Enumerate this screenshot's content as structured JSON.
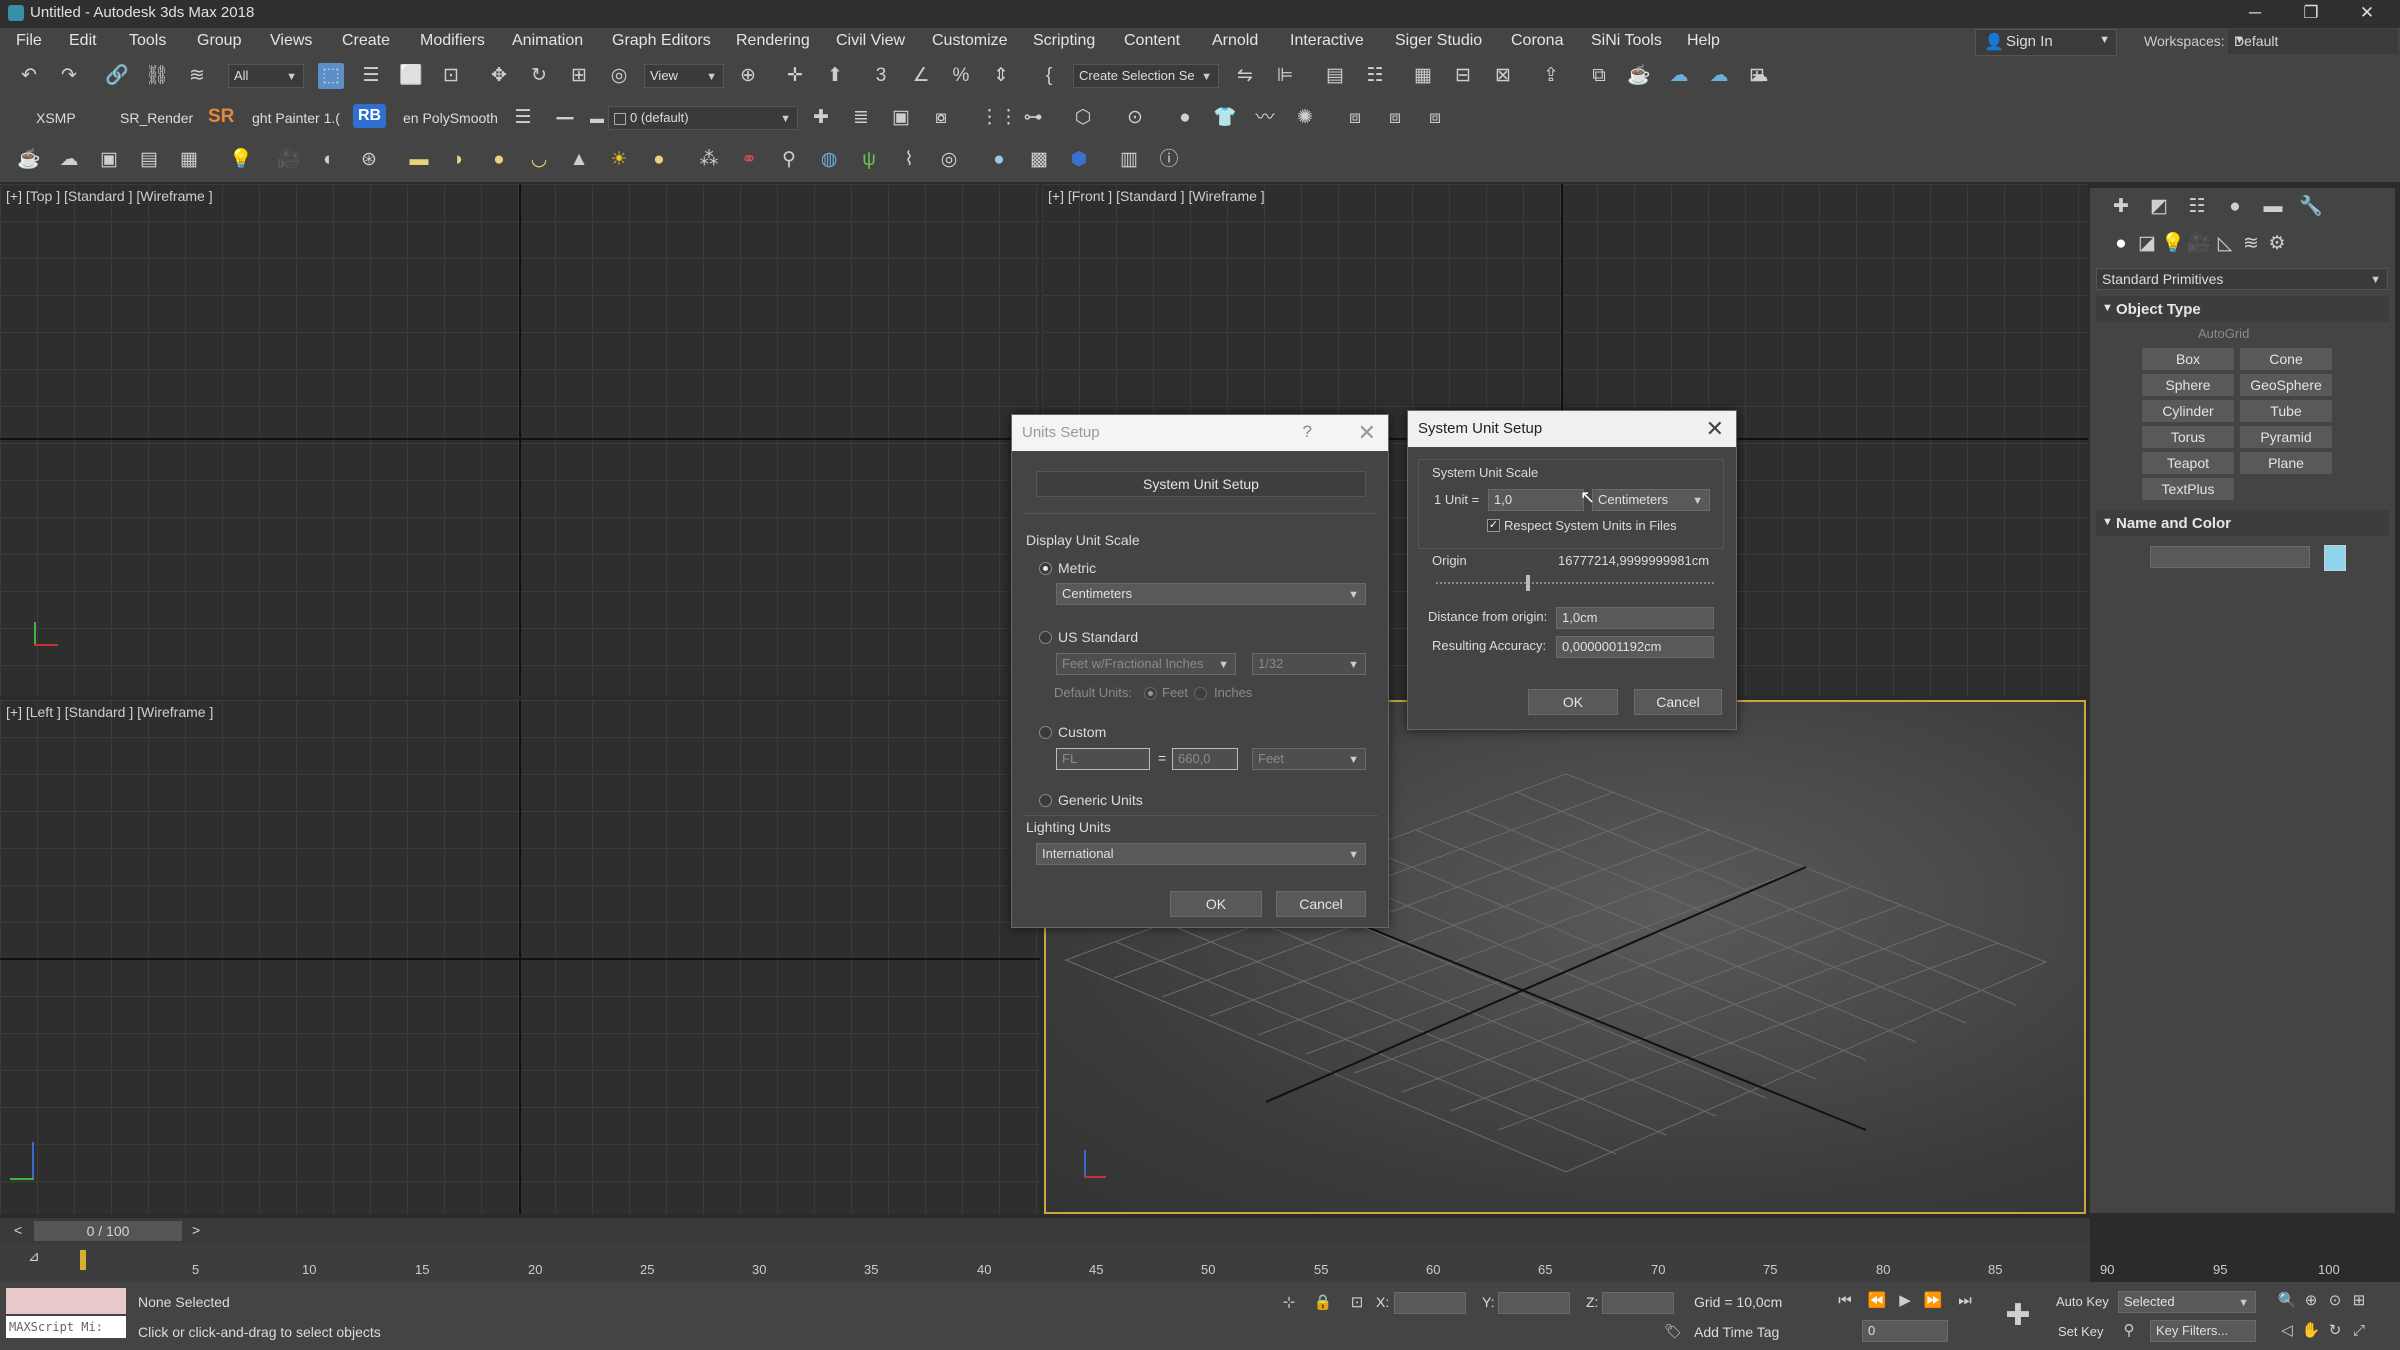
{
  "window": {
    "title": "Untitled - Autodesk 3ds Max 2018",
    "minimize": "─",
    "maximize": "❐",
    "close": "✕"
  },
  "menu": [
    "File",
    "Edit",
    "Tools",
    "Group",
    "Views",
    "Create",
    "Modifiers",
    "Animation",
    "Graph Editors",
    "Rendering",
    "Civil View",
    "Customize",
    "Scripting",
    "Content",
    "Arnold",
    "Interactive",
    "Siger Studio",
    "Corona",
    "SiNi Tools",
    "Help"
  ],
  "account": {
    "sign_in": "Sign In",
    "workspaces_label": "Workspaces:",
    "workspace": "Default"
  },
  "toolbar": {
    "filter": "All",
    "refcoord": "View",
    "selection_set": "Create Selection Se",
    "xsmp": "XSMP",
    "sr_render": "SR_Render",
    "sr": "SR",
    "light_painter": "ght Painter 1.(",
    "rb": "RB",
    "polysmooth": "en PolySmooth",
    "layer": "0 (default)"
  },
  "viewports": {
    "top": "[+] [Top ] [Standard ] [Wireframe ]",
    "front": "[+] [Front ] [Standard ] [Wireframe ]",
    "left": "[+] [Left ] [Standard ] [Wireframe ]"
  },
  "command_panel": {
    "category": "Standard Primitives",
    "object_type": "Object Type",
    "autogrid": "AutoGrid",
    "primitives": [
      "Box",
      "Cone",
      "Sphere",
      "GeoSphere",
      "Cylinder",
      "Tube",
      "Torus",
      "Pyramid",
      "Teapot",
      "Plane",
      "TextPlus"
    ],
    "name_and_color": "Name and Color",
    "color": "#8fd3ec"
  },
  "units_setup": {
    "title": "Units Setup",
    "help": "?",
    "close": "✕",
    "system_unit_button": "System Unit Setup",
    "display_unit_scale": "Display Unit Scale",
    "metric": "Metric",
    "metric_unit": "Centimeters",
    "us_standard": "US Standard",
    "us_unit": "Feet w/Fractional Inches",
    "us_fraction": "1/32",
    "default_units": "Default Units:",
    "feet": "Feet",
    "inches": "Inches",
    "custom": "Custom",
    "custom_name": "FL",
    "custom_eq": "=",
    "custom_value": "660,0",
    "custom_unit": "Feet",
    "generic_units": "Generic Units",
    "lighting_units": "Lighting Units",
    "lighting_value": "International",
    "ok": "OK",
    "cancel": "Cancel"
  },
  "system_unit_setup": {
    "title": "System Unit Setup",
    "close": "✕",
    "scale_group": "System Unit Scale",
    "unit_label": "1 Unit =",
    "unit_value": "1,0",
    "unit_type": "Centimeters",
    "respect": "Respect System Units in Files",
    "respect_checked": true,
    "origin_label": "Origin",
    "origin_value": "16777214,9999999981cm",
    "distance_label": "Distance from origin:",
    "distance_value": "1,0cm",
    "accuracy_label": "Resulting Accuracy:",
    "accuracy_value": "0,0000001192cm",
    "ok": "OK",
    "cancel": "Cancel"
  },
  "timeline": {
    "counter": "0 / 100",
    "ticks": [
      "5",
      "10",
      "15",
      "20",
      "25",
      "30",
      "35",
      "40",
      "45",
      "50",
      "55",
      "60",
      "65",
      "70",
      "75",
      "80",
      "85",
      "90",
      "95",
      "100"
    ]
  },
  "status": {
    "maxscript": "MAXScript Mi:",
    "selection": "None Selected",
    "prompt": "Click or click-and-drag to select objects",
    "x_label": "X:",
    "y_label": "Y:",
    "z_label": "Z:",
    "grid": "Grid = 10,0cm",
    "add_time_tag": "Add Time Tag",
    "auto_key": "Auto Key",
    "set_key": "Set Key",
    "key_mode": "Selected",
    "key_filters": "Key Filters...",
    "frame": "0"
  }
}
